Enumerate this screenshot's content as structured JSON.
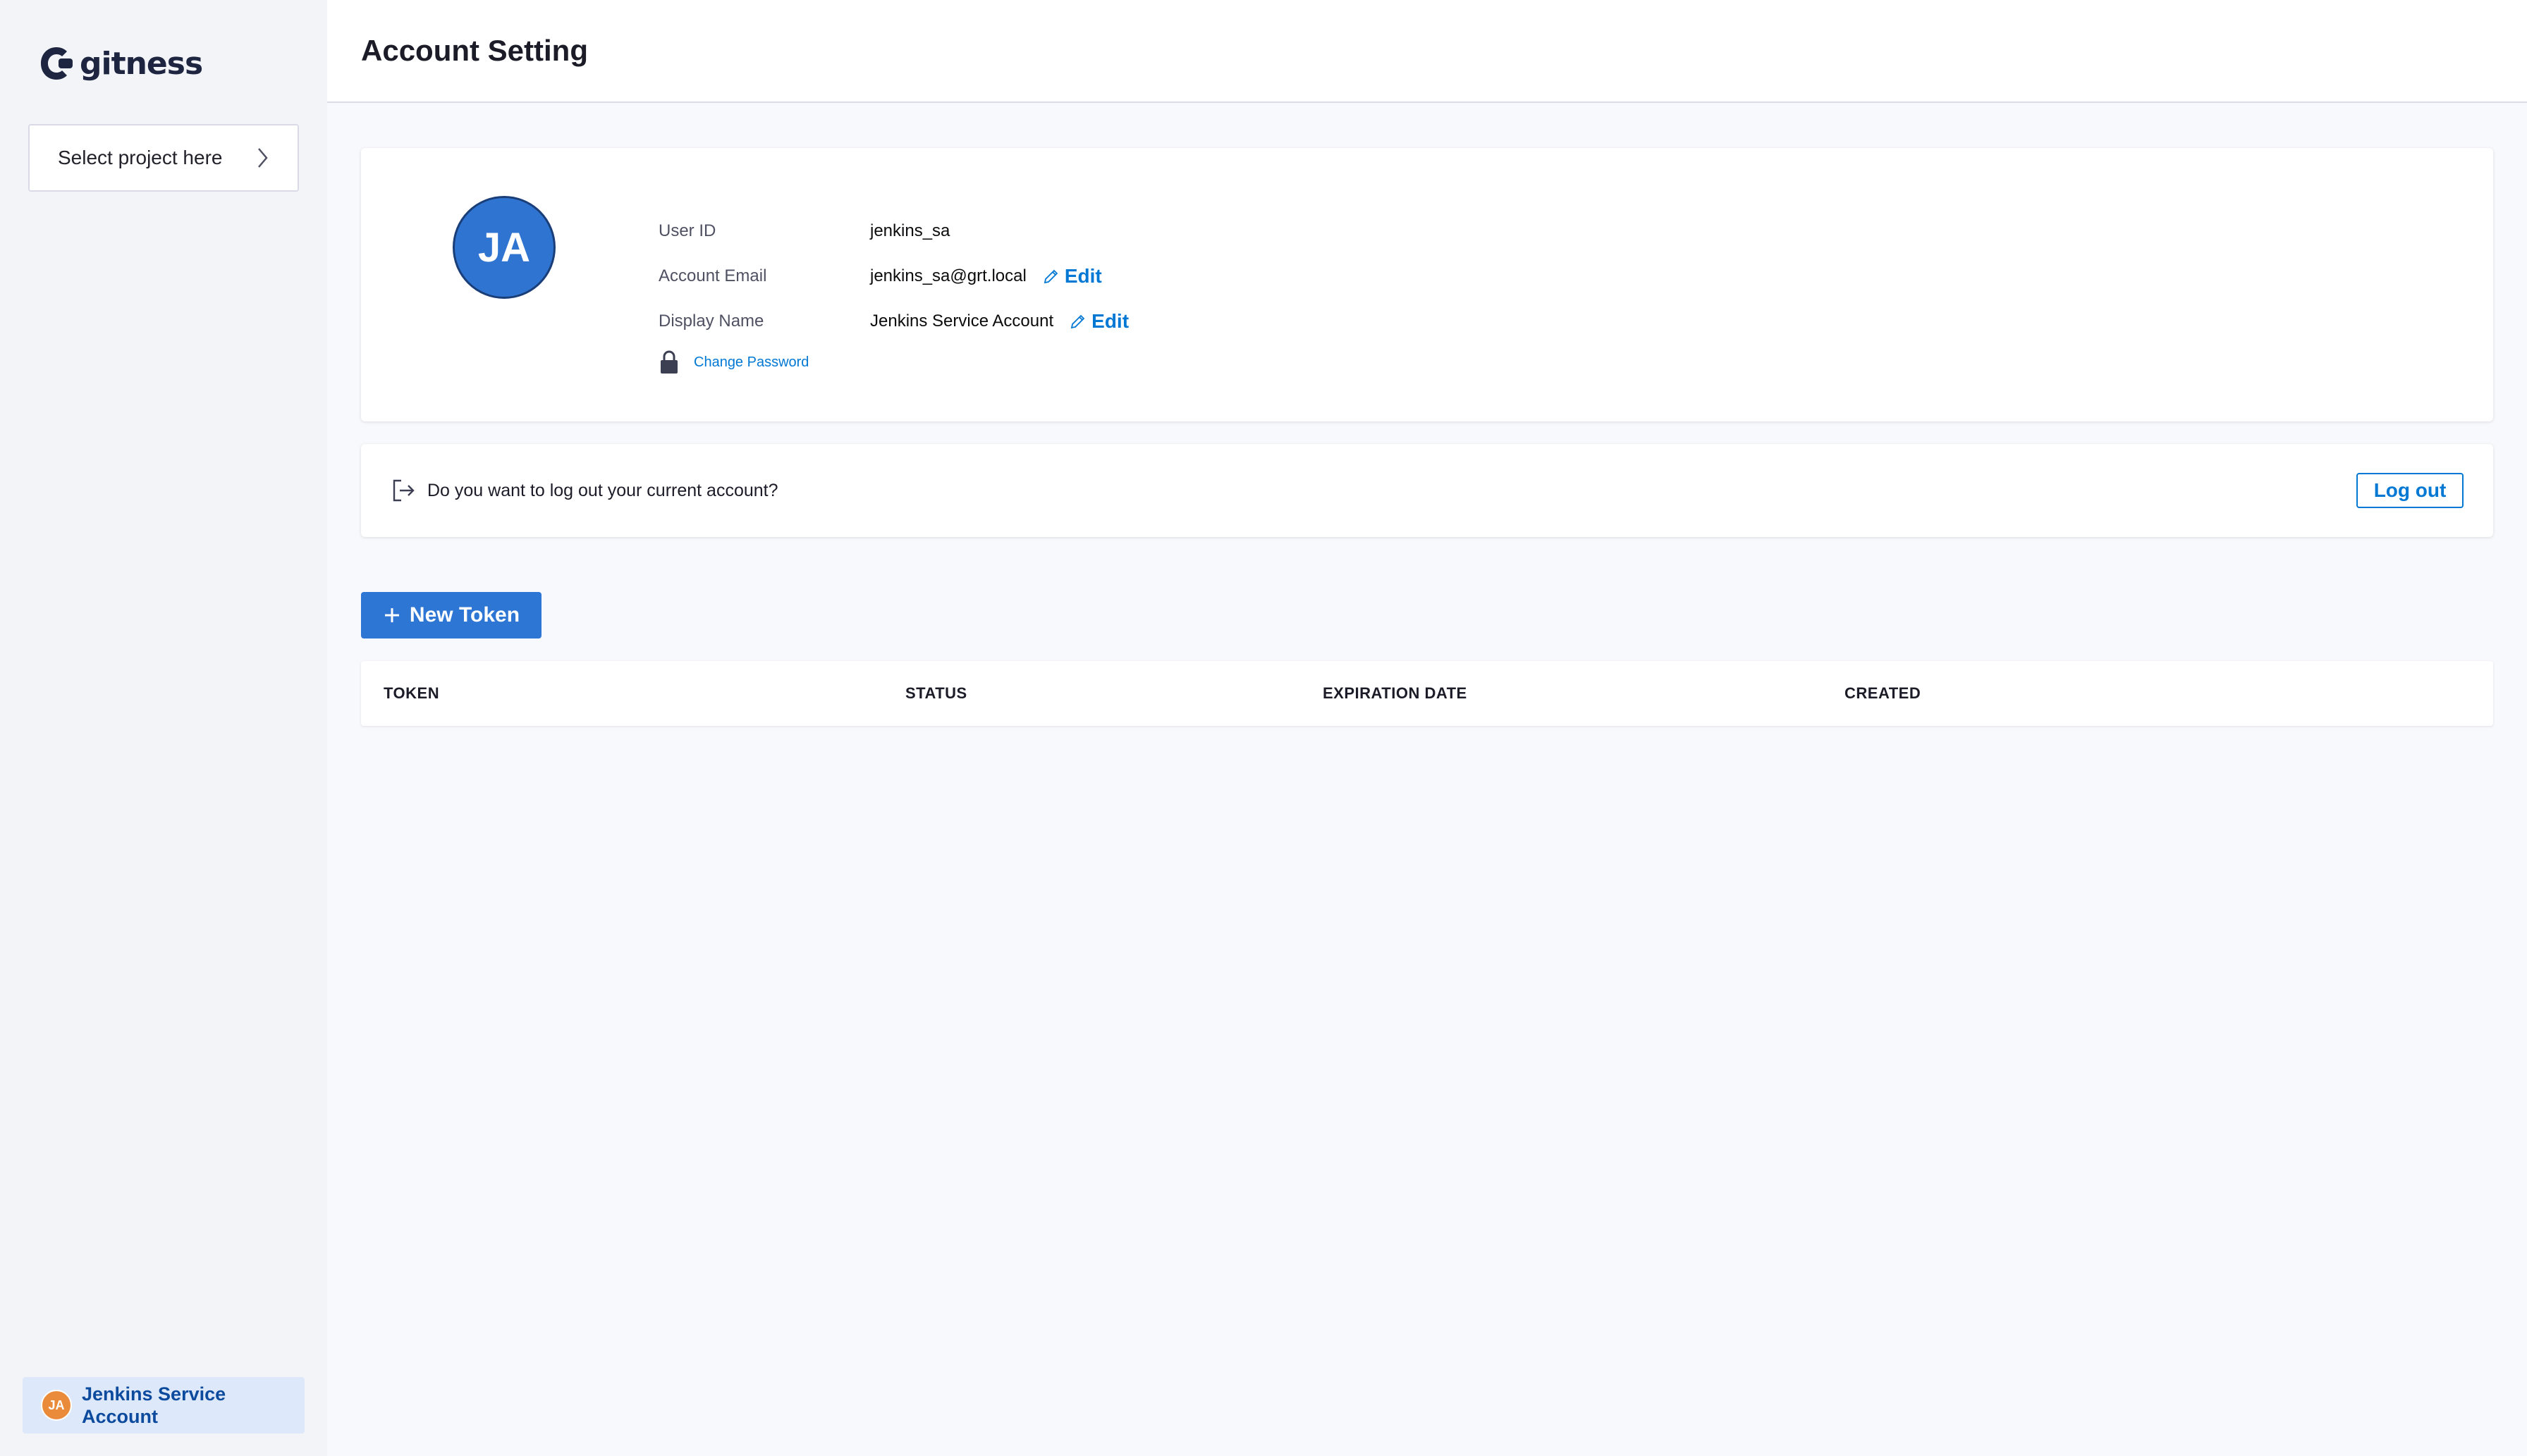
{
  "brand": {
    "name": "gitness",
    "logo_icon": "gitness-logo-icon"
  },
  "sidebar": {
    "project_select_label": "Select project here",
    "project_select_icon": "chevron-right-icon",
    "user": {
      "initials": "JA",
      "name": "Jenkins Service Account",
      "avatar_color": "#ea8a3b"
    }
  },
  "header": {
    "title": "Account Setting"
  },
  "profile": {
    "avatar_initials": "JA",
    "avatar_color": "#2f74d1",
    "fields": [
      {
        "label": "User ID",
        "value": "jenkins_sa",
        "editable": false
      },
      {
        "label": "Account Email",
        "value": "jenkins_sa@grt.local",
        "editable": true,
        "edit_label": "Edit"
      },
      {
        "label": "Display Name",
        "value": "Jenkins Service Account",
        "editable": true,
        "edit_label": "Edit"
      }
    ],
    "change_password_label": "Change Password",
    "change_password_icon": "lock-icon",
    "edit_icon": "pencil-icon"
  },
  "logout": {
    "icon": "logout-icon",
    "prompt": "Do you want to log out your current account?",
    "button_label": "Log out"
  },
  "tokens": {
    "new_token_label": "New Token",
    "new_token_icon": "plus-icon",
    "columns": [
      "TOKEN",
      "STATUS",
      "EXPIRATION DATE",
      "CREATED"
    ],
    "rows": []
  },
  "colors": {
    "accent": "#0278d5",
    "primary_button": "#2d76d4",
    "sidebar_bg": "#f3f4f8",
    "user_chip_bg": "#dde9fb"
  }
}
